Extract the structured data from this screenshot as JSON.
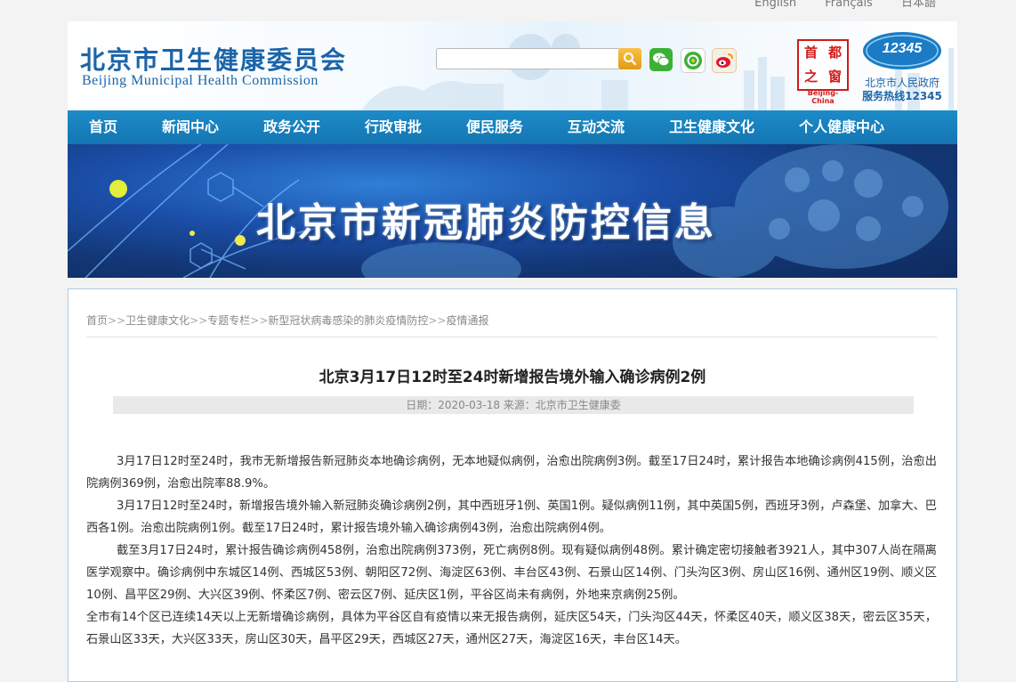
{
  "lang": {
    "en": "English",
    "fr": "Français",
    "ja": "日本語"
  },
  "header": {
    "title_cn": "北京市卫生健康委员会",
    "title_en": "Beijing Municipal Health Commission",
    "search_placeholder": "",
    "capital": {
      "chars": [
        "首",
        "都",
        "之",
        "窗"
      ],
      "sub": "Beijing-China"
    },
    "hotline": {
      "number": "12345",
      "line1": "北京市人民政府",
      "line2": "服务热线12345"
    }
  },
  "nav": {
    "items": [
      "首页",
      "新闻中心",
      "政务公开",
      "行政审批",
      "便民服务",
      "互动交流",
      "卫生健康文化",
      "个人健康中心"
    ]
  },
  "banner": {
    "title": "北京市新冠肺炎防控信息"
  },
  "breadcrumb": {
    "items": [
      "首页",
      "卫生健康文化",
      "专题专栏",
      "新型冠状病毒感染的肺炎疫情防控",
      "疫情通报"
    ],
    "sep": ">>"
  },
  "article": {
    "title": "北京3月17日12时至24时新增报告境外输入确诊病例2例",
    "meta": "日期：2020-03-18 来源：北京市卫生健康委",
    "paragraphs": [
      "3月17日12时至24时，我市无新增报告新冠肺炎本地确诊病例，无本地疑似病例，治愈出院病例3例。截至17日24时，累计报告本地确诊病例415例，治愈出院病例369例，治愈出院率88.9%。",
      "3月17日12时至24时，新增报告境外输入新冠肺炎确诊病例2例，其中西班牙1例、英国1例。疑似病例11例，其中英国5例，西班牙3例，卢森堡、加拿大、巴西各1例。治愈出院病例1例。截至17日24时，累计报告境外输入确诊病例43例，治愈出院病例4例。",
      "截至3月17日24时，累计报告确诊病例458例，治愈出院病例373例，死亡病例8例。现有疑似病例48例。累计确定密切接触者3921人，其中307人尚在隔离医学观察中。确诊病例中东城区14例、西城区53例、朝阳区72例、海淀区63例、丰台区43例、石景山区14例、门头沟区3例、房山区16例、通州区19例、顺义区10例、昌平区29例、大兴区39例、怀柔区7例、密云区7例、延庆区1例，平谷区尚未有病例，外地来京病例25例。",
      "全市有14个区已连续14天以上无新增确诊病例，具体为平谷区自有疫情以来无报告病例，延庆区54天，门头沟区44天，怀柔区40天，顺义区38天，密云区35天，石景山区33天，大兴区33天，房山区30天，昌平区29天，西城区27天，通州区27天，海淀区16天，丰台区14天。"
    ]
  }
}
